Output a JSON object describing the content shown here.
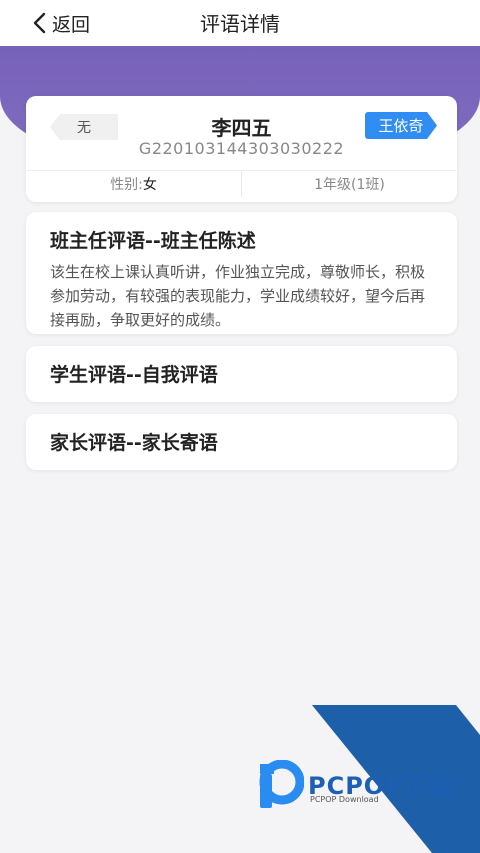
{
  "header": {
    "back_label": "返回",
    "title": "评语详情"
  },
  "student": {
    "left_tag": "无",
    "name": "李四五",
    "id": "G220103144303030222",
    "teacher_tag": "王依奇",
    "gender_label": "性别:",
    "gender_value": "女",
    "grade_class": "1年级(1班)"
  },
  "comments": [
    {
      "title": "班主任评语--班主任陈述",
      "body": "该生在校上课认真听讲，作业独立完成，尊敬师长，积极参加劳动，有较强的表现能力，学业成绩较好，望今后再接再励，争取更好的成绩。"
    },
    {
      "title": "学生评语--自我评语"
    },
    {
      "title": "家长评语--家长寄语"
    }
  ],
  "watermark": {
    "brand": "PCPOP下载",
    "sub": "PCPOP Download"
  },
  "colors": {
    "purple_band": "#7762b9",
    "teacher_tag": "#2f8df4",
    "watermark_blue": "#1d5fb4"
  },
  "icons": {
    "back": "chevron-left-icon"
  }
}
